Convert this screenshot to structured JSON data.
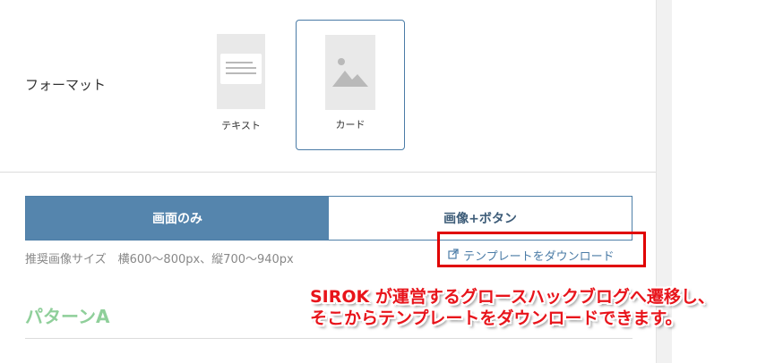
{
  "format": {
    "label": "フォーマット",
    "options": [
      {
        "label": "テキスト",
        "selected": false,
        "icon": "text-layout-icon"
      },
      {
        "label": "カード",
        "selected": true,
        "icon": "image-card-icon"
      }
    ]
  },
  "display_mode": {
    "tabs": [
      {
        "label": "画面のみ",
        "active": true
      },
      {
        "label": "画像+ボタン",
        "active": false
      }
    ]
  },
  "size_note": "推奨画像サイズ　横600〜800px、縦700〜940px",
  "download_link": {
    "label": "テンプレートをダウンロード",
    "icon": "external-link-icon"
  },
  "pattern_title": "パターンA",
  "annotation": {
    "line1": "SIROK が運営するグロースハックブログへ遷移し、",
    "line2": "そこからテンプレートをダウンロードできます。"
  },
  "colors": {
    "accent": "#5585ad",
    "border_accent": "#4a7ba6",
    "pattern_green": "#8fcf9a",
    "annotation_red": "#e8141b"
  }
}
